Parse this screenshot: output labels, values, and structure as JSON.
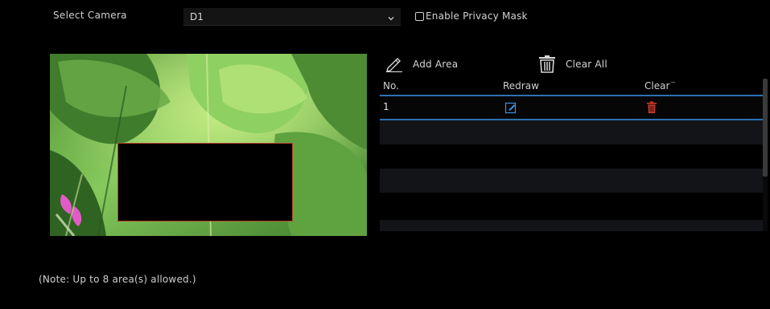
{
  "camera": {
    "label": "Select Camera",
    "selected": "D1",
    "dropdown_icon": "chevron-down-icon"
  },
  "privacy_mask": {
    "label": "Enable Privacy Mask",
    "checked": false
  },
  "toolbar": {
    "add_label": "Add Area",
    "add_icon": "pencil-icon",
    "clear_label": "Clear All",
    "clear_icon": "trash-icon"
  },
  "table": {
    "headers": {
      "no": "No.",
      "redraw": "Redraw",
      "clear": "Clear"
    },
    "rows": [
      {
        "no": "1",
        "redraw_icon": "edit-icon",
        "clear_icon": "delete-icon"
      }
    ]
  },
  "note": "(Note: Up to 8 area(s) allowed.)",
  "colors": {
    "accent": "#2f6fb0",
    "mask_border": "#b7462a",
    "delete_icon": "#d23a2a",
    "edit_icon": "#3c8ee0"
  }
}
